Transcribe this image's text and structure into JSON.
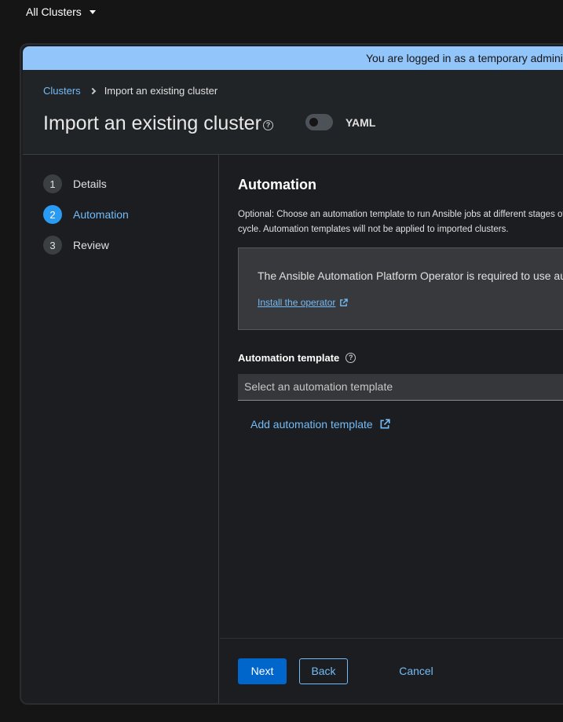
{
  "top_bar": {
    "cluster_switcher": "All Clusters"
  },
  "banner": {
    "text": "You are logged in as a temporary administrative user. Update the cluster OAuth configuration to allow others to log in."
  },
  "header": {
    "breadcrumb": {
      "parent": "Clusters",
      "current": "Import an existing cluster"
    },
    "title": "Import an existing cluster",
    "yaml_toggle": {
      "label": "YAML",
      "on": false
    }
  },
  "wizard": {
    "steps": [
      {
        "number": "1",
        "label": "Details",
        "active": false
      },
      {
        "number": "2",
        "label": "Automation",
        "active": true
      },
      {
        "number": "3",
        "label": "Review",
        "active": false
      }
    ]
  },
  "content": {
    "title": "Automation",
    "description": "Optional: Choose an automation template to run Ansible jobs at different stages of a cluster's life cycle. Automation templates will not be applied to imported clusters.",
    "alert": {
      "text": "The Ansible Automation Platform Operator is required to use automation templates.",
      "link": "Install the operator"
    },
    "field_label": "Automation template",
    "select_placeholder": "Select an automation template",
    "add_link": "Add automation template"
  },
  "footer": {
    "next": "Next",
    "back": "Back",
    "cancel": "Cancel"
  },
  "colors": {
    "accent": "#73bcf7",
    "primary_button": "#0066cc",
    "banner": "#92c5f9",
    "active_step": "#2b9af3"
  }
}
